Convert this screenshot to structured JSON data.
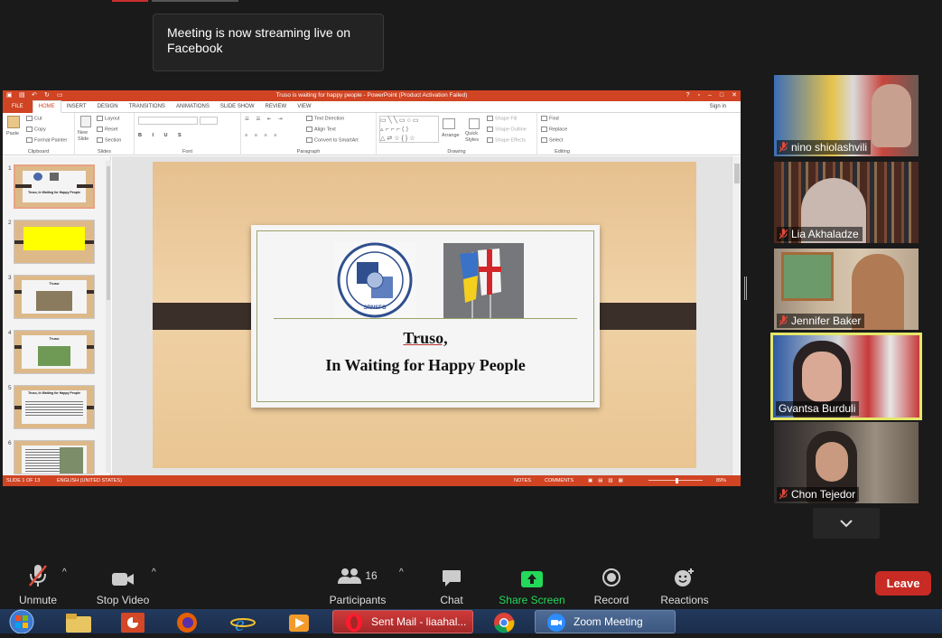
{
  "toast": {
    "text": "Meeting is now streaming live on Facebook"
  },
  "ppt": {
    "title": "Truso is waiting for happy people - PowerPoint (Product Activation Failed)",
    "tabs": [
      "FILE",
      "HOME",
      "INSERT",
      "DESIGN",
      "TRANSITIONS",
      "ANIMATIONS",
      "SLIDE SHOW",
      "REVIEW",
      "VIEW"
    ],
    "selected_tab": "HOME",
    "sign_in": "Sign in",
    "ribbon": {
      "clipboard": {
        "paste": "Paste",
        "cut": "Cut",
        "copy": "Copy",
        "format_painter": "Format Painter",
        "label": "Clipboard"
      },
      "slides": {
        "new_slide": "New Slide",
        "layout": "Layout",
        "reset": "Reset",
        "section": "Section",
        "label": "Slides"
      },
      "font": {
        "label": "Font"
      },
      "paragraph": {
        "text_direction": "Text Direction",
        "align_text": "Align Text",
        "convert": "Convert to SmartArt",
        "label": "Paragraph"
      },
      "drawing": {
        "arrange": "Arrange",
        "quick_styles": "Quick Styles",
        "shape_fill": "Shape Fill",
        "shape_outline": "Shape Outline",
        "shape_effects": "Shape Effects",
        "label": "Drawing"
      },
      "editing": {
        "find": "Find",
        "replace": "Replace",
        "select": "Select",
        "label": "Editing"
      }
    },
    "thumbnails": [
      {
        "num": "1",
        "text": "Truso, In Waiting for Happy People"
      },
      {
        "num": "2",
        "text": ""
      },
      {
        "num": "3",
        "text": "Truso"
      },
      {
        "num": "4",
        "text": "Truso"
      },
      {
        "num": "5",
        "text": "Truso, In Waiting for Happy People"
      },
      {
        "num": "6",
        "text": ""
      }
    ],
    "slide": {
      "title_line1": "Truso,",
      "title_line2": "In Waiting for Happy People",
      "logo_text": "SRNSFG"
    },
    "status": {
      "slide": "SLIDE 1 OF 13",
      "language": "ENGLISH (UNITED STATES)",
      "notes": "NOTES",
      "comments": "COMMENTS",
      "zoom": "89%"
    }
  },
  "participants": [
    {
      "name": "nino shiolashvili",
      "muted": true
    },
    {
      "name": "Lia Akhaladze",
      "muted": true
    },
    {
      "name": "Jennifer Baker",
      "muted": true
    },
    {
      "name": "Gvantsa Burduli",
      "muted": false,
      "active": true
    },
    {
      "name": "Chon Tejedor",
      "muted": true
    }
  ],
  "toolbar": {
    "unmute": "Unmute",
    "stop_video": "Stop Video",
    "participants": "Participants",
    "participants_count": "16",
    "chat": "Chat",
    "share_screen": "Share Screen",
    "record": "Record",
    "reactions": "Reactions",
    "leave": "Leave"
  },
  "taskbar": {
    "sent_mail": "Sent Mail - liaahal...",
    "zoom": "Zoom Meeting"
  },
  "colors": {
    "ppt_accent": "#d04423",
    "share_green": "#23d959",
    "leave_red": "#c72b24",
    "active_speaker": "#e5e76a"
  }
}
